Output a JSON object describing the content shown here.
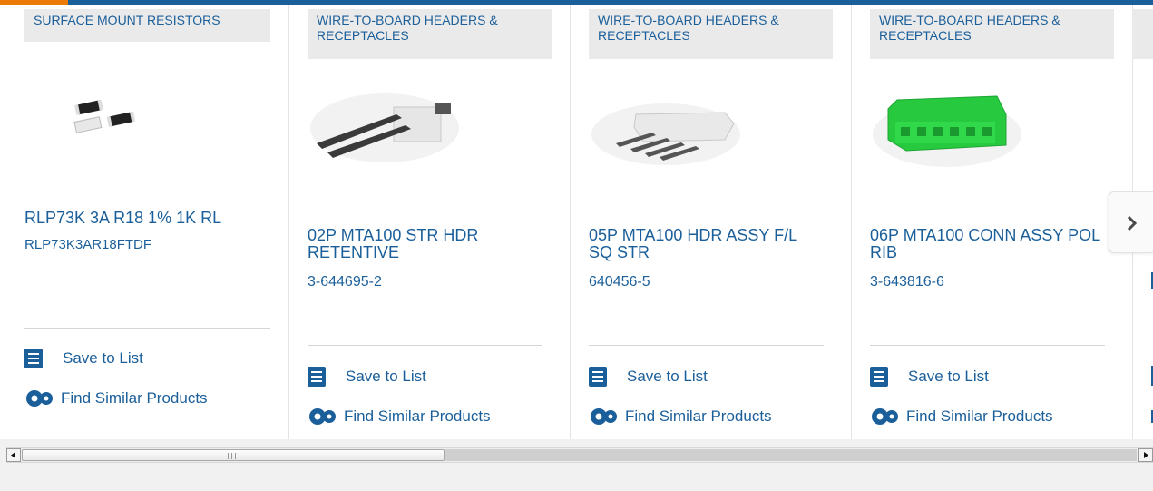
{
  "colors": {
    "accent": "#1b5f9a",
    "highlight": "#ec7a08",
    "panel": "#eaeaea"
  },
  "icons": {
    "list": "checklist-icon",
    "similar": "gears-icon",
    "next": "chevron-right-icon",
    "scroll_left": "triangle-left-icon",
    "scroll_right": "triangle-right-icon"
  },
  "actions": {
    "save_label": "Save to List",
    "similar_label": "Find Similar Products"
  },
  "products": [
    {
      "category": "SURFACE MOUNT RESISTORS",
      "name": "RLP73K 3A R18 1% 1K RL",
      "part_number": "RLP73K3AR18FTDF"
    },
    {
      "category": "WIRE-TO-BOARD HEADERS & RECEPTACLES",
      "name": "02P MTA100 STR HDR RETENTIVE",
      "part_number": "3-644695-2"
    },
    {
      "category": "WIRE-TO-BOARD HEADERS & RECEPTACLES",
      "name": "05P MTA100 HDR ASSY F/L SQ STR",
      "part_number": "640456-5"
    },
    {
      "category": "WIRE-TO-BOARD HEADERS & RECEPTACLES",
      "name": "06P MTA100 CONN ASSY POL RIB",
      "part_number": "3-643816-6"
    }
  ],
  "scrollbar": {
    "position_fraction": 0.0
  }
}
